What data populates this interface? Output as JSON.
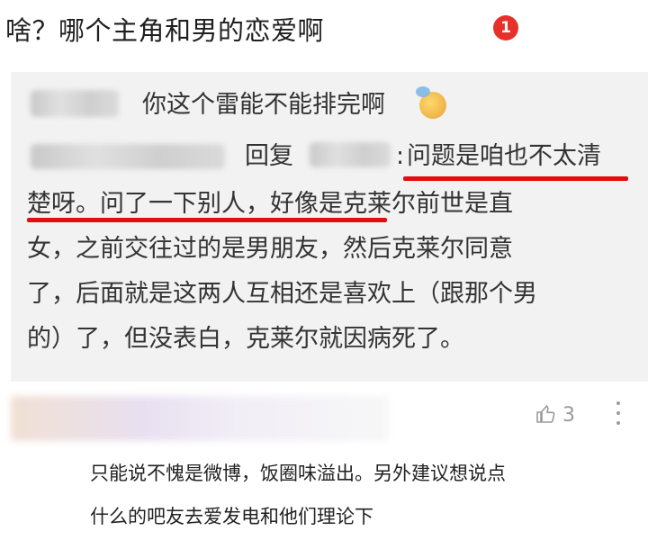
{
  "top": {
    "text": "啥？哪个主角和男的恋爱啊",
    "badge": "1"
  },
  "quote": {
    "line1": "你这个雷能不能排完啊",
    "reply_label": "回复",
    "colon": ":",
    "line2_tail": "问题是咱也不太清",
    "line3": "楚呀。问了一下别人，好像是克莱尔前世是直",
    "line4": "女，之前交往过的是男朋友，然后克莱尔同意",
    "line5": "了，后面就是这两人互相还是喜欢上（跟那个男",
    "line6": "的）了，但没表白，克莱尔就因病死了。"
  },
  "comment": {
    "like_count": "3",
    "text_line1": "只能说不愧是微博，饭圈味溢出。另外建议想说点",
    "text_line2": "什么的吧友去爱发电和他们理论下"
  },
  "colors": {
    "underline": "#e30d0d",
    "badge": "#e8302a",
    "quote_bg": "#f2f2f2"
  }
}
